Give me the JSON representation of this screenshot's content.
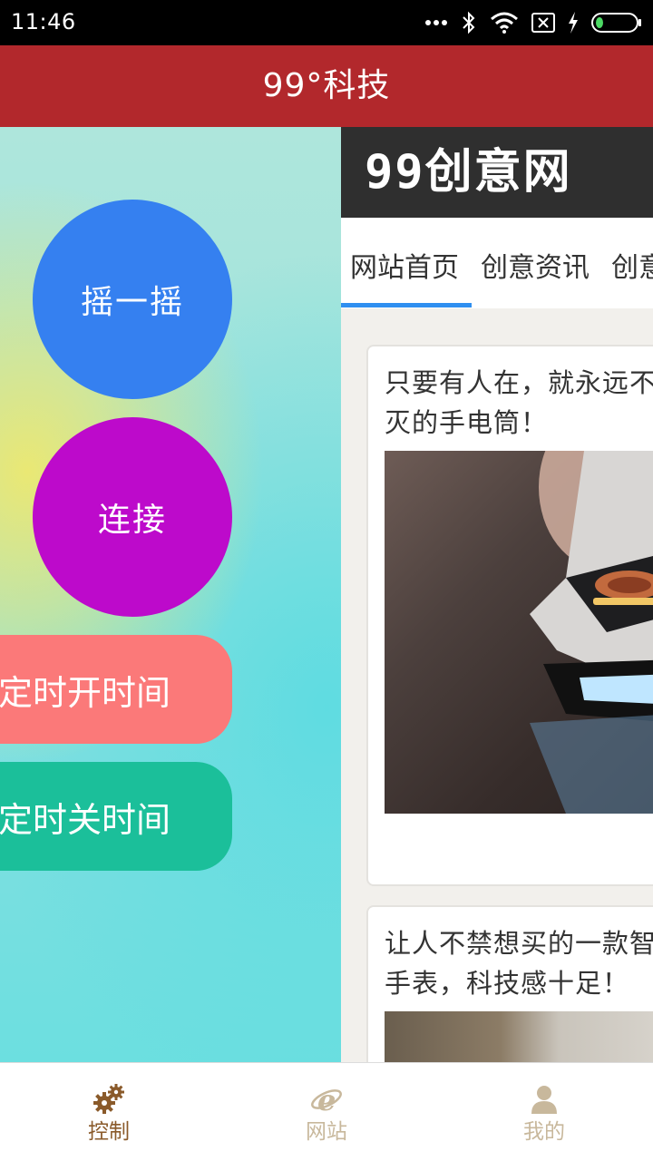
{
  "status_bar": {
    "time": "11:46",
    "icons": [
      "more-dots-icon",
      "bluetooth-icon",
      "wifi-icon",
      "sim-off-icon",
      "charging-icon",
      "battery-icon"
    ]
  },
  "app_bar": {
    "title": "99°科技",
    "color": "#b2282c"
  },
  "controls": {
    "shake_label": "摇一摇",
    "connect_label": "连接",
    "on_time_label": "定时开时间",
    "off_time_label": "定时关时间",
    "colors": {
      "shake": "#3580f0",
      "connect": "#bd0acb",
      "on_time": "#fb7979",
      "off_time": "#1bbf9a"
    }
  },
  "web": {
    "logo_digits": "99",
    "logo_text": "创意网",
    "tabs": [
      {
        "label": "网站首页",
        "active": true
      },
      {
        "label": "创意资讯",
        "active": false
      },
      {
        "label": "创意",
        "active": false
      }
    ],
    "accent": "#2f8ff0",
    "articles": [
      {
        "title": "只要有人在，就永远不会灭的手电筒！"
      },
      {
        "title": "让人不禁想买的一款智能手表，科技感十足！"
      }
    ]
  },
  "bottom_nav": {
    "items": [
      {
        "label": "控制",
        "icon": "gears-icon",
        "active": true
      },
      {
        "label": "网站",
        "icon": "ie-browser-icon",
        "active": false
      },
      {
        "label": "我的",
        "icon": "user-icon",
        "active": false
      }
    ]
  }
}
